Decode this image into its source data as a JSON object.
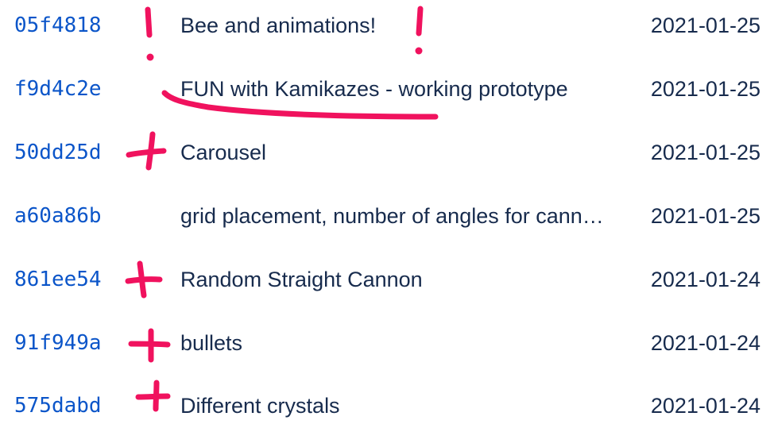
{
  "commits": [
    {
      "hash": "05f4818",
      "message": "Bee and animations!",
      "date": "2021-01-25"
    },
    {
      "hash": "f9d4c2e",
      "message": "FUN with Kamikazes - working prototype",
      "date": "2021-01-25"
    },
    {
      "hash": "50dd25d",
      "message": "Carousel",
      "date": "2021-01-25"
    },
    {
      "hash": "a60a86b",
      "message": "grid placement, number of angles for cannons",
      "date": "2021-01-25"
    },
    {
      "hash": "861ee54",
      "message": "Random Straight Cannon",
      "date": "2021-01-24"
    },
    {
      "hash": "91f949a",
      "message": "bullets",
      "date": "2021-01-24"
    },
    {
      "hash": "575dabd",
      "message": "Different crystals",
      "date": "2021-01-24"
    }
  ],
  "annotations": {
    "color": "#f0125e",
    "marks": [
      {
        "type": "exclamation-icon",
        "row": 0
      },
      {
        "type": "exclamation-icon",
        "row": 0
      },
      {
        "type": "underline",
        "row": 1
      },
      {
        "type": "plus-icon",
        "row": 2
      },
      {
        "type": "plus-icon",
        "row": 4
      },
      {
        "type": "plus-icon",
        "row": 5
      },
      {
        "type": "plus-icon",
        "row": 6
      }
    ]
  },
  "colors": {
    "hash_link": "#0b55c9",
    "text": "#172b4d",
    "background": "#ffffff"
  }
}
